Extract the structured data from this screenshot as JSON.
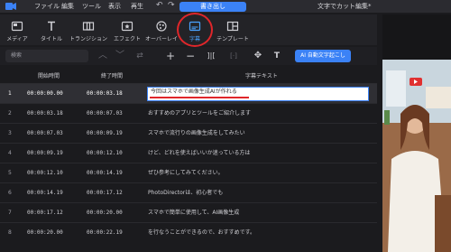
{
  "menu": {
    "file": "ファイル",
    "edit": "編集",
    "tools": "ツール",
    "view": "表示",
    "play": "再生",
    "export": "書き出し",
    "project_title": "文字でカット編集*"
  },
  "toolbar": {
    "items": [
      {
        "label": "メディア",
        "icon": "media-icon"
      },
      {
        "label": "タイトル",
        "icon": "title-icon"
      },
      {
        "label": "トランジション",
        "icon": "transition-icon"
      },
      {
        "label": "エフェクト",
        "icon": "effect-icon"
      },
      {
        "label": "オーバーレイ",
        "icon": "overlay-icon"
      },
      {
        "label": "字幕",
        "icon": "subtitle-icon"
      },
      {
        "label": "テンプレート",
        "icon": "template-icon"
      }
    ],
    "active_index": 5
  },
  "subbar": {
    "search_placeholder": "検索",
    "ai_button": "AI 自動文字起こし"
  },
  "table": {
    "headers": {
      "start": "開始時間",
      "end": "終了時間",
      "text": "字幕テキスト"
    },
    "rows": [
      {
        "num": "1",
        "start": "00:00:00.00",
        "end": "00:00:03.18",
        "text": "今回はスマホで画像生成AIが作れる",
        "selected": true
      },
      {
        "num": "2",
        "start": "00:00:03.18",
        "end": "00:00:07.03",
        "text": "おすすめのアプリとツールをご紹介します",
        "selected": false
      },
      {
        "num": "3",
        "start": "00:00:07.03",
        "end": "00:00:09.19",
        "text": "スマホで流行りの画像生成をしてみたい",
        "selected": false
      },
      {
        "num": "4",
        "start": "00:00:09.19",
        "end": "00:00:12.10",
        "text": "けど、どれを使えばいいか迷っている方は",
        "selected": false
      },
      {
        "num": "5",
        "start": "00:00:12.10",
        "end": "00:00:14.19",
        "text": "ぜひ参考にしてみてください。",
        "selected": false
      },
      {
        "num": "6",
        "start": "00:00:14.19",
        "end": "00:00:17.12",
        "text": "PhotoDirectorは、初心者でも",
        "selected": false
      },
      {
        "num": "7",
        "start": "00:00:17.12",
        "end": "00:00:20.00",
        "text": "スマホで簡単に使用して、AI画像生成",
        "selected": false
      },
      {
        "num": "8",
        "start": "00:00:20.00",
        "end": "00:00:22.19",
        "text": "を行なうことができるので、おすすめです。",
        "selected": false
      }
    ]
  },
  "colors": {
    "accent": "#3b82f6",
    "highlight": "#e0262a",
    "background": "#1b1b1e"
  }
}
